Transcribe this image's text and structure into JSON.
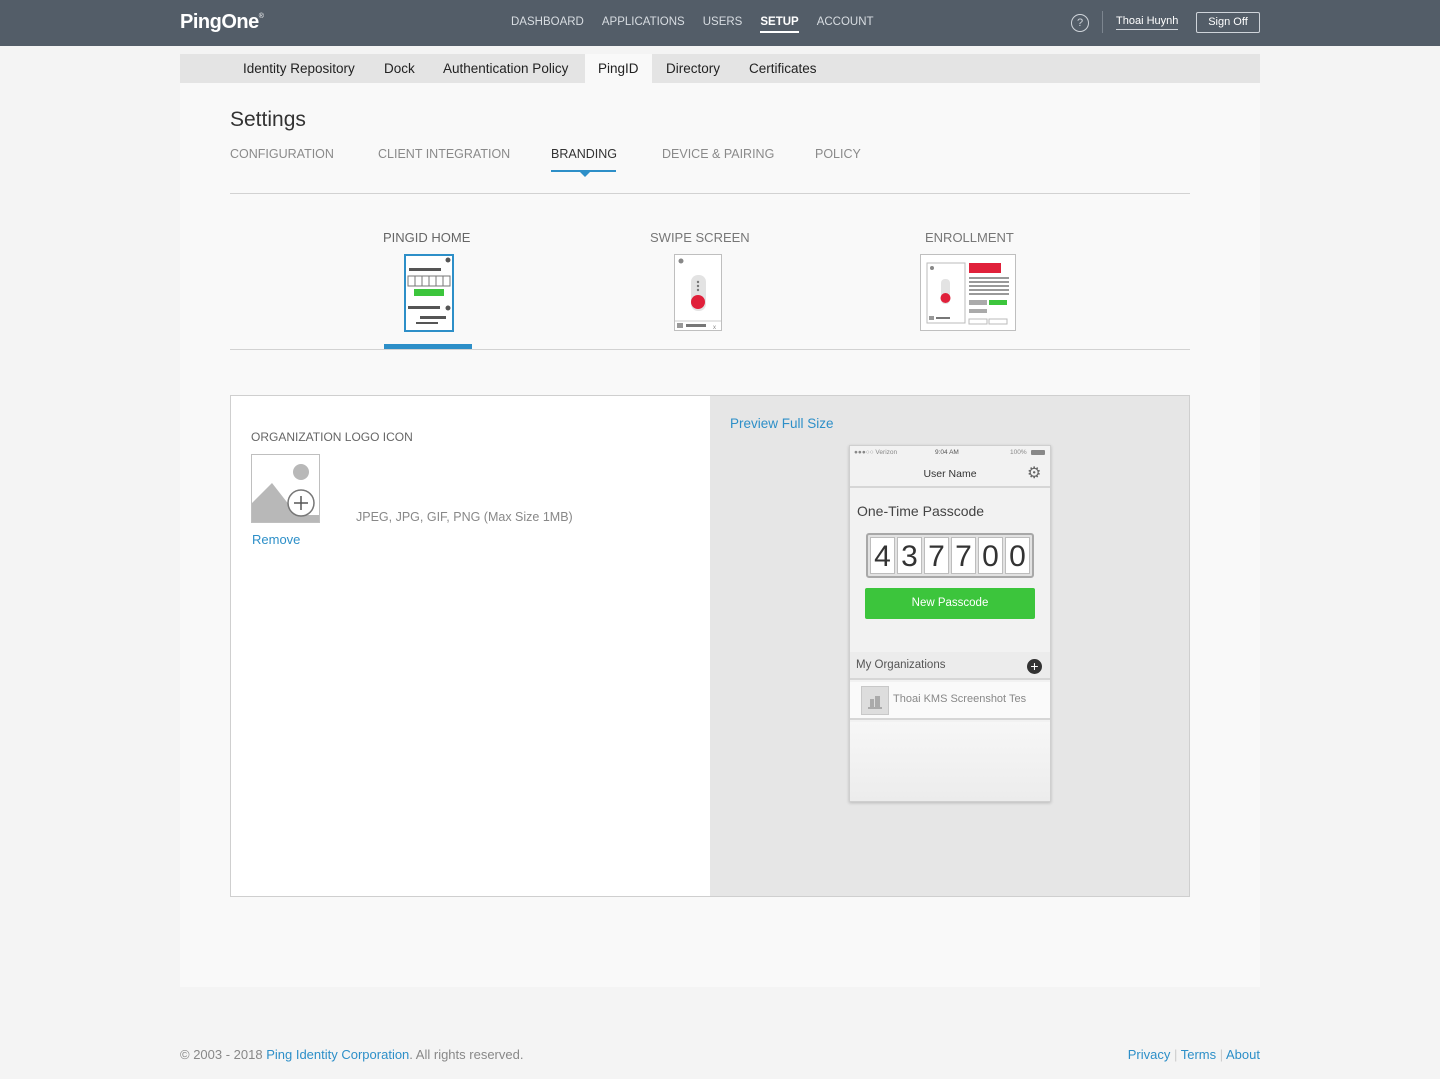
{
  "app": {
    "logo": "PingOne",
    "logo_mark": "®"
  },
  "topnav": {
    "items": [
      "DASHBOARD",
      "APPLICATIONS",
      "USERS",
      "SETUP",
      "ACCOUNT"
    ],
    "active": "SETUP",
    "help": "?",
    "user": "Thoai Huynh",
    "signoff": "Sign Off"
  },
  "subtabs": {
    "items": [
      "Identity Repository",
      "Dock",
      "Authentication Policy",
      "PingID",
      "Directory",
      "Certificates"
    ],
    "active": "PingID"
  },
  "page": {
    "title": "Settings"
  },
  "section_tabs": {
    "items": [
      "CONFIGURATION",
      "CLIENT INTEGRATION",
      "BRANDING",
      "DEVICE & PAIRING",
      "POLICY"
    ],
    "active": "BRANDING"
  },
  "branding": {
    "items": [
      "PINGID HOME",
      "SWIPE SCREEN",
      "ENROLLMENT"
    ],
    "active": "PINGID HOME"
  },
  "logo_panel": {
    "label": "ORGANIZATION LOGO ICON",
    "remove": "Remove",
    "formats": "JPEG, JPG, GIF, PNG (Max Size 1MB)"
  },
  "preview": {
    "link": "Preview Full Size",
    "status": {
      "carrier": "●●●○○ Verizon",
      "time": "9:04 AM",
      "battery": "100%"
    },
    "header_user": "User Name",
    "otp_title": "One-Time Passcode",
    "otp_digits": [
      "4",
      "3",
      "7",
      "7",
      "0",
      "0"
    ],
    "new_passcode": "New Passcode",
    "orgs_title": "My Organizations",
    "org_name": "Thoai KMS Screenshot Tes"
  },
  "colors": {
    "topbar": "#535d68",
    "accent": "#2d8fc8",
    "green": "#3cc53c",
    "red": "#e0203a"
  },
  "footer": {
    "copyright": "© 2003 - 2018 ",
    "company": "Ping Identity Corporation",
    "rights": ". All rights reserved.",
    "links": [
      "Privacy",
      "Terms",
      "About"
    ]
  }
}
